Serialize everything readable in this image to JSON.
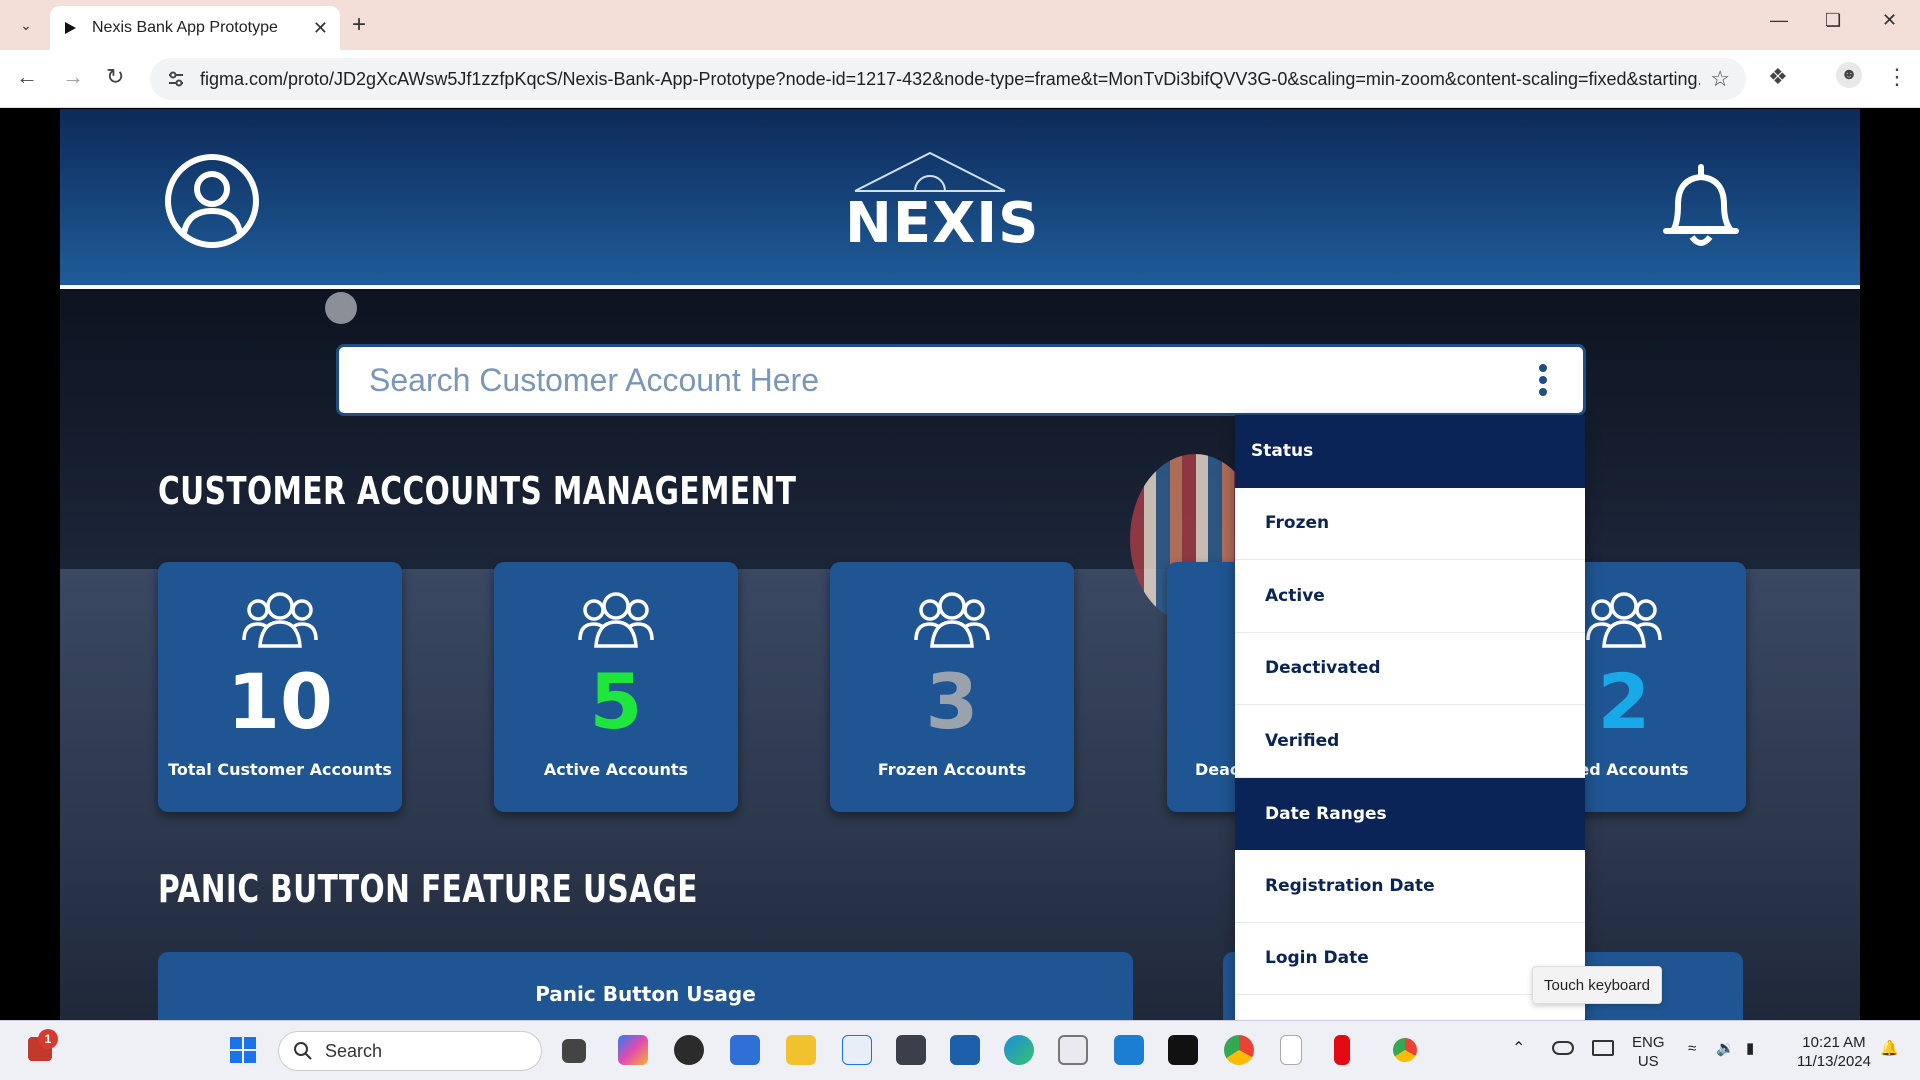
{
  "browser": {
    "tab_title": "Nexis Bank App Prototype",
    "url": "figma.com/proto/JD2gXcAWsw5Jf1zzfpKqcS/Nexis-Bank-App-Prototype?node-id=1217-432&node-type=frame&t=MonTvDi3bifQVV3G-0&scaling=min-zoom&content-scaling=fixed&starting..."
  },
  "app": {
    "logo_text": "NEXIS",
    "search_placeholder": "Search Customer Account Here",
    "section_accounts": "CUSTOMER ACCOUNTS MANAGEMENT",
    "section_panic": "PANIC BUTTON FEATURE USAGE",
    "cards": [
      {
        "value": "10",
        "label": "Total Customer Accounts",
        "color": "#ffffff"
      },
      {
        "value": "5",
        "label": "Active Accounts",
        "color": "#1ee63c"
      },
      {
        "value": "3",
        "label": "Frozen Accounts",
        "color": "#9aa3ad"
      },
      {
        "value": "",
        "label": "Deac",
        "color": "#ffffff"
      },
      {
        "value": "2",
        "label": "ored Accounts",
        "color": "#17a9e8"
      }
    ],
    "panel_title": "Panic Button Usage",
    "dropdown": {
      "status_header": "Status",
      "items": [
        "Frozen",
        "Active",
        "Deactivated",
        "Verified"
      ],
      "date_header": "Date Ranges",
      "date_items": [
        "Registration Date",
        "Login Date"
      ]
    },
    "tooltip": "Touch keyboard"
  },
  "taskbar": {
    "search_label": "Search",
    "notification_count": "1",
    "lang_top": "ENG",
    "lang_bottom": "US",
    "time": "10:21 AM",
    "date": "11/13/2024"
  }
}
